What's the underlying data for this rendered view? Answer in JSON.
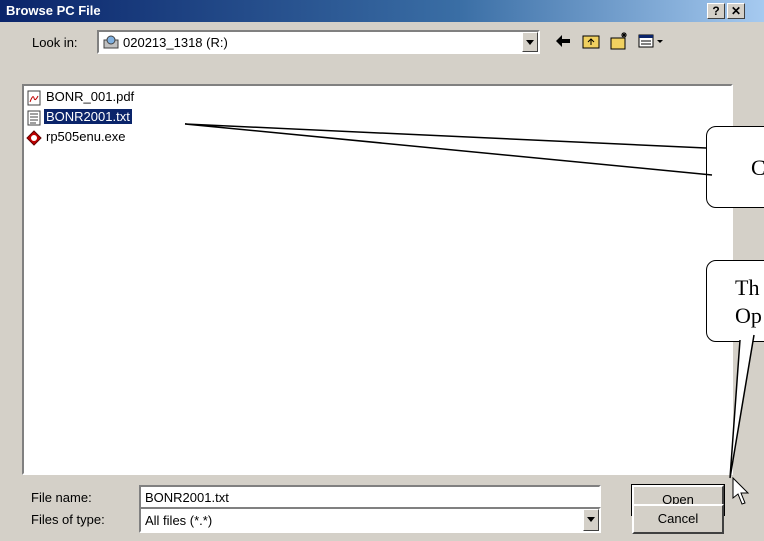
{
  "window": {
    "title": "Browse PC File",
    "help_label": "?",
    "close_label": "✕"
  },
  "lookin": {
    "label": "Look in:",
    "value": "020213_1318 (R:)"
  },
  "toolbar": {
    "back_icon": "back-arrow-icon",
    "up_icon": "up-folder-icon",
    "new_icon": "new-folder-icon",
    "view_icon": "view-menu-icon"
  },
  "files": [
    {
      "name": "BONR_001.pdf",
      "icon": "pdf-file-icon",
      "selected": false
    },
    {
      "name": "BONR2001.txt",
      "icon": "text-file-icon",
      "selected": true
    },
    {
      "name": "rp505enu.exe",
      "icon": "exe-file-icon",
      "selected": false
    }
  ],
  "filename": {
    "label": "File name:",
    "value": "BONR2001.txt"
  },
  "filetype": {
    "label": "Files of type:",
    "value": "All files (*.*)"
  },
  "buttons": {
    "open": "Open",
    "cancel": "Cancel"
  },
  "callouts": {
    "c1": "C",
    "c2_line1": "Th",
    "c2_line2": "Op"
  }
}
